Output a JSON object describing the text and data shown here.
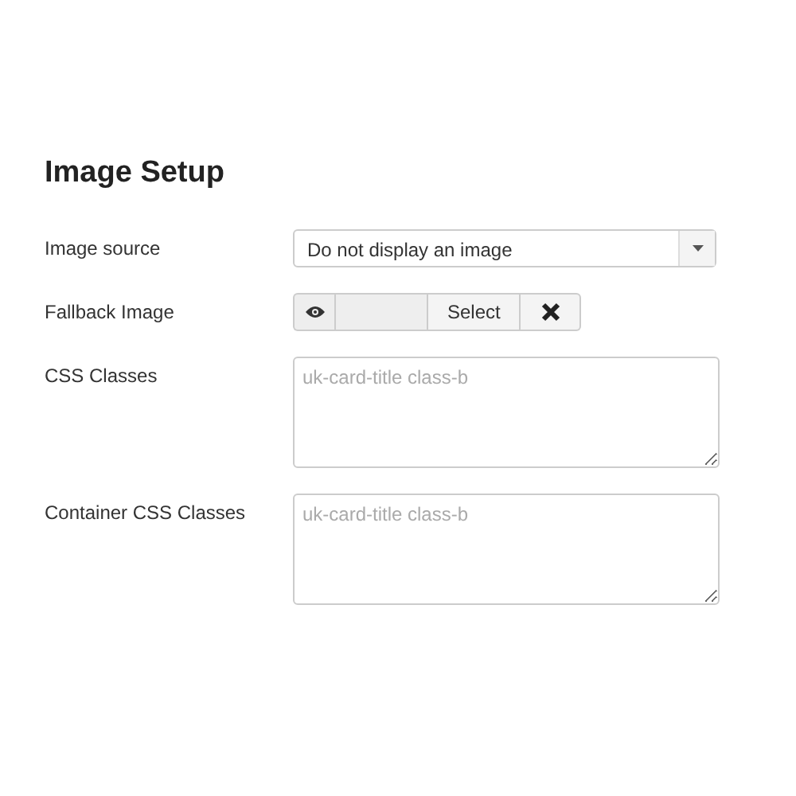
{
  "heading": "Image Setup",
  "fields": [
    {
      "kind": "select",
      "label": "Image source",
      "value": "Do not display an image"
    },
    {
      "kind": "media",
      "label": "Fallback Image",
      "button": "Select"
    },
    {
      "kind": "textarea",
      "label": "CSS Classes",
      "placeholder": "uk-card-title class-b"
    },
    {
      "kind": "textarea",
      "label": "Container CSS Classes",
      "placeholder": "uk-card-title class-b"
    }
  ]
}
